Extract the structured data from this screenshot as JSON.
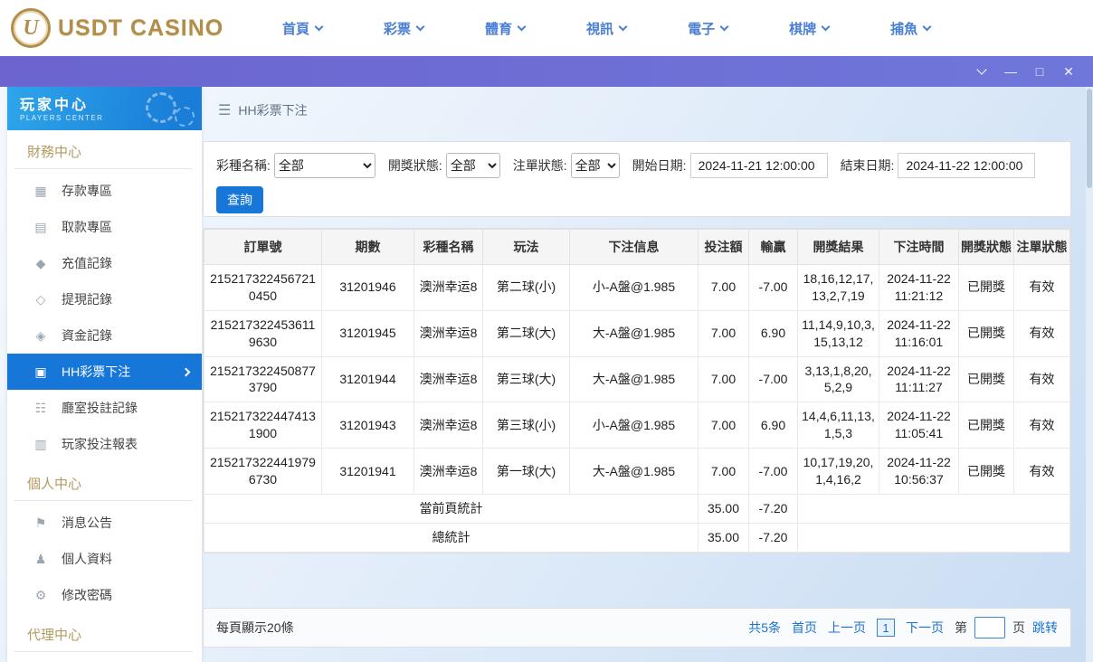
{
  "header": {
    "logo_text": "USDT CASINO",
    "nav": [
      "首頁",
      "彩票",
      "體育",
      "視訊",
      "電子",
      "棋牌",
      "捕魚"
    ]
  },
  "sidebar": {
    "title": "玩家中心",
    "subtitle": "PLAYERS CENTER",
    "sections": [
      {
        "label": "財務中心",
        "items": [
          "存款專區",
          "取款專區",
          "充值記錄",
          "提現記錄",
          "資金記錄",
          "HH彩票下注",
          "廳室投註記錄",
          "玩家投注報表"
        ]
      },
      {
        "label": "個人中心",
        "items": [
          "消息公告",
          "個人資料",
          "修改密碼"
        ]
      },
      {
        "label": "代理中心",
        "items": []
      }
    ],
    "active_item": "HH彩票下注"
  },
  "breadcrumb": {
    "label": "HH彩票下注"
  },
  "filters": {
    "lottery_label": "彩種名稱:",
    "lottery_value": "全部",
    "draw_status_label": "開獎狀態:",
    "draw_status_value": "全部",
    "order_status_label": "注單狀態:",
    "order_status_value": "全部",
    "start_label": "開始日期:",
    "start_value": "2024-11-21 12:00:00",
    "end_label": "結束日期:",
    "end_value": "2024-11-22 12:00:00",
    "search_button": "查詢"
  },
  "table": {
    "headers": [
      "訂單號",
      "期數",
      "彩種名稱",
      "玩法",
      "下注信息",
      "投注額",
      "輸贏",
      "開獎結果",
      "下注時間",
      "開獎狀態",
      "注單狀態"
    ],
    "rows": [
      {
        "order_id": "2152173224567210450",
        "period": "31201946",
        "lottery": "澳洲幸运8",
        "play": "第二球(小)",
        "info": "小-A盤@1.985",
        "bet": "7.00",
        "win_loss": "-7.00",
        "result": "18,16,12,17,13,2,7,19",
        "time": "2024-11-22 11:21:12",
        "draw_status": "已開獎",
        "order_status": "有效"
      },
      {
        "order_id": "2152173224536119630",
        "period": "31201945",
        "lottery": "澳洲幸运8",
        "play": "第二球(大)",
        "info": "大-A盤@1.985",
        "bet": "7.00",
        "win_loss": "6.90",
        "result": "11,14,9,10,3,15,13,12",
        "time": "2024-11-22 11:16:01",
        "draw_status": "已開獎",
        "order_status": "有效"
      },
      {
        "order_id": "2152173224508773790",
        "period": "31201944",
        "lottery": "澳洲幸运8",
        "play": "第三球(大)",
        "info": "大-A盤@1.985",
        "bet": "7.00",
        "win_loss": "-7.00",
        "result": "3,13,1,8,20,5,2,9",
        "time": "2024-11-22 11:11:27",
        "draw_status": "已開獎",
        "order_status": "有效"
      },
      {
        "order_id": "2152173224474131900",
        "period": "31201943",
        "lottery": "澳洲幸运8",
        "play": "第三球(小)",
        "info": "小-A盤@1.985",
        "bet": "7.00",
        "win_loss": "6.90",
        "result": "14,4,6,11,13,1,5,3",
        "time": "2024-11-22 11:05:41",
        "draw_status": "已開獎",
        "order_status": "有效"
      },
      {
        "order_id": "2152173224419796730",
        "period": "31201941",
        "lottery": "澳洲幸运8",
        "play": "第一球(大)",
        "info": "大-A盤@1.985",
        "bet": "7.00",
        "win_loss": "-7.00",
        "result": "10,17,19,20,1,4,16,2",
        "time": "2024-11-22 10:56:37",
        "draw_status": "已開獎",
        "order_status": "有效"
      }
    ],
    "summary_rows": [
      {
        "label": "當前頁統計",
        "bet": "35.00",
        "win_loss": "-7.20"
      },
      {
        "label": "總統計",
        "bet": "35.00",
        "win_loss": "-7.20"
      }
    ]
  },
  "pagination": {
    "per_page": "每頁顯示20條",
    "total": "共5条",
    "first": "首页",
    "prev": "上一页",
    "current": "1",
    "next": "下一页",
    "jump_prefix": "第",
    "jump_suffix": "页",
    "jump_button": "跳转"
  },
  "colors": {
    "accent_blue": "#1677d9",
    "gold": "#b28e4a",
    "titlebar_purple": "#6c64cf"
  }
}
